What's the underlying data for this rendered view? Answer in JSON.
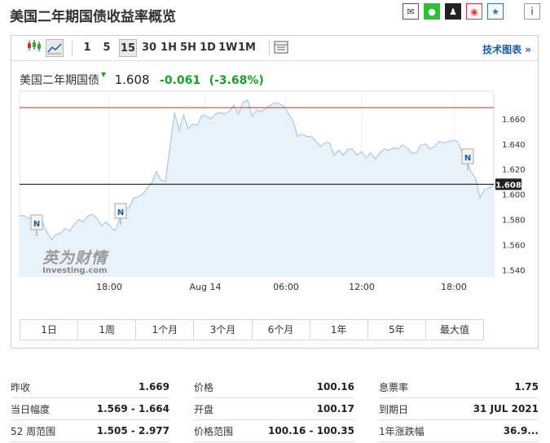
{
  "header": {
    "title": "美国二年期国债收益率概览"
  },
  "share_icons": [
    {
      "name": "mail-icon",
      "glyph": "✉"
    },
    {
      "name": "wechat-icon",
      "glyph": "●"
    },
    {
      "name": "qq-icon",
      "glyph": "♟"
    },
    {
      "name": "weibo-icon",
      "glyph": "◉"
    },
    {
      "name": "favorite-star-icon",
      "glyph": "★"
    }
  ],
  "info_glyph": "i",
  "toolbar": {
    "intervals": [
      "1",
      "5",
      "15",
      "30",
      "1H",
      "5H",
      "1D",
      "1W",
      "1M"
    ],
    "active": "15",
    "tech_chart_link": "技术图表 »"
  },
  "quote": {
    "name": "美国二年期国债",
    "price": "1.608",
    "change": "-0.061",
    "change_pct": "(-3.68%)"
  },
  "chart_data": {
    "type": "area",
    "title": "",
    "xlabel": "",
    "ylabel": "",
    "x_ticks": [
      "18:00",
      "Aug 14",
      "06:00",
      "12:00",
      "18:00"
    ],
    "y_ticks": [
      "1.660",
      "1.640",
      "1.620",
      "1.600",
      "1.580",
      "1.560",
      "1.540"
    ],
    "ylim": [
      1.535,
      1.682
    ],
    "last_value_label": "1.608",
    "reference_line": 1.608,
    "resistance_line": 1.669,
    "news_markers": [
      "N",
      "N",
      "N"
    ],
    "values": [
      1.583,
      1.583,
      1.581,
      1.582,
      1.576,
      1.578,
      1.57,
      1.564,
      1.568,
      1.569,
      1.573,
      1.571,
      1.576,
      1.58,
      1.578,
      1.583,
      1.584,
      1.581,
      1.575,
      1.578,
      1.574,
      1.571,
      1.581,
      1.589,
      1.589,
      1.597,
      1.598,
      1.6,
      1.605,
      1.609,
      1.618,
      1.611,
      1.61,
      1.638,
      1.665,
      1.651,
      1.663,
      1.652,
      1.656,
      1.655,
      1.663,
      1.662,
      1.66,
      1.664,
      1.665,
      1.664,
      1.666,
      1.671,
      1.664,
      1.673,
      1.675,
      1.662,
      1.667,
      1.666,
      1.668,
      1.671,
      1.673,
      1.672,
      1.67,
      1.664,
      1.658,
      1.646,
      1.648,
      1.646,
      1.646,
      1.642,
      1.638,
      1.641,
      1.641,
      1.631,
      1.635,
      1.631,
      1.636,
      1.636,
      1.631,
      1.634,
      1.629,
      1.633,
      1.628,
      1.633,
      1.636,
      1.635,
      1.637,
      1.636,
      1.639,
      1.637,
      1.633,
      1.633,
      1.639,
      1.64,
      1.636,
      1.638,
      1.642,
      1.641,
      1.642,
      1.643,
      1.642,
      1.634,
      1.628,
      1.618,
      1.613,
      1.597,
      1.604,
      1.605,
      1.608
    ]
  },
  "ranges": [
    "1日",
    "1周",
    "1个月",
    "3个月",
    "6个月",
    "1年",
    "5年",
    "最大值"
  ],
  "watermark": {
    "cn": "英为财情",
    "en": "Investing.com"
  },
  "stats": [
    [
      {
        "k": "昨收",
        "v": "1.669"
      },
      {
        "k": "当日幅度",
        "v": "1.569 - 1.664"
      },
      {
        "k": "52 周范围",
        "v": "1.505 - 2.977"
      }
    ],
    [
      {
        "k": "价格",
        "v": "100.16"
      },
      {
        "k": "开盘",
        "v": "100.17"
      },
      {
        "k": "价格范围",
        "v": "100.16 - 100.35"
      }
    ],
    [
      {
        "k": "息票率",
        "v": "1.75"
      },
      {
        "k": "到期日",
        "v": "31 JUL 2021"
      },
      {
        "k": "1年涨跌幅",
        "v": "36.9..."
      }
    ]
  ],
  "colors": {
    "line": "#a9c9e6",
    "fill": "#e9f1f9",
    "resistance": "#c0392b",
    "price_line": "#000000",
    "up_green": "#1f9c2d"
  }
}
